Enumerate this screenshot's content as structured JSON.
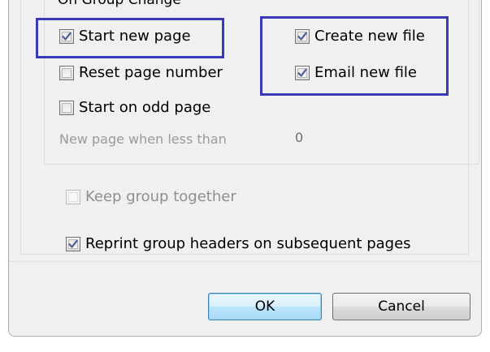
{
  "group": {
    "title": "On Group Change",
    "start_new_page": {
      "label": "Start new page",
      "checked": true
    },
    "reset_page_number": {
      "label": "Reset page number",
      "checked": false
    },
    "start_on_odd_page": {
      "label": "Start on odd page",
      "checked": false
    },
    "create_new_file": {
      "label": "Create new file",
      "checked": true
    },
    "email_new_file": {
      "label": "Email new file",
      "checked": true
    },
    "new_page_when_less_than": {
      "label": "New page when less than",
      "value": "0"
    }
  },
  "options": {
    "keep_group_together": {
      "label": "Keep group together",
      "checked": false,
      "disabled": true
    },
    "reprint_headers": {
      "label": "Reprint group headers on subsequent pages",
      "checked": true
    }
  },
  "buttons": {
    "ok_label": "OK",
    "cancel_label": "Cancel"
  },
  "colors": {
    "highlight": "#3a39b8",
    "check": "#4a5f97",
    "dialog_bg": "#f0f0f0"
  }
}
